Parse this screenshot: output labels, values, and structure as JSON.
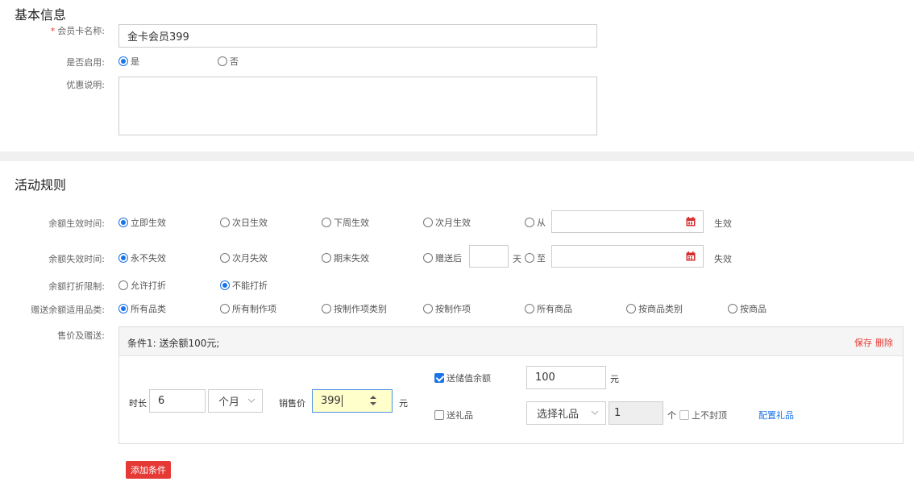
{
  "basic": {
    "title": "基本信息",
    "card_name_label": "会员卡名称:",
    "card_name_value": "金卡会员399",
    "enabled_label": "是否启用:",
    "enabled_options": [
      "是",
      "否"
    ],
    "desc_label": "优惠说明:"
  },
  "rules": {
    "title": "活动规则",
    "effective": {
      "label": "余额生效时间:",
      "options": [
        "立即生效",
        "次日生效",
        "下周生效",
        "次月生效",
        "从"
      ],
      "suffix": "生效"
    },
    "expire": {
      "label": "余额失效时间:",
      "options": [
        "永不失效",
        "次月失效",
        "期末失效",
        "赠送后",
        "至"
      ],
      "days_unit": "天",
      "suffix": "失效"
    },
    "discount": {
      "label": "余额打折限制:",
      "options": [
        "允许打折",
        "不能打折"
      ]
    },
    "category": {
      "label": "赠送余额适用品类:",
      "options": [
        "所有品类",
        "所有制作项",
        "按制作项类别",
        "按制作项",
        "所有商品",
        "按商品类别",
        "按商品"
      ]
    },
    "price_label": "售价及赠送:",
    "condition": {
      "title": "条件1: 送余额100元;",
      "save": "保存",
      "delete": "删除",
      "duration_label": "时长",
      "duration_value": "6",
      "unit_value": "个月",
      "price_label": "销售价",
      "price_value": "399",
      "yuan": "元",
      "gift_balance_label": "送储值余额",
      "gift_balance_value": "100",
      "gift_item_label": "送礼品",
      "gift_select": "选择礼品",
      "gift_qty": "1",
      "qty_unit": "个",
      "no_cap_label": "上不封顶",
      "config_link": "配置礼品"
    },
    "add_condition": "添加条件"
  },
  "colors": {
    "accent": "#1a73e8",
    "danger": "#e53935",
    "highlight": "#ffffcc"
  }
}
